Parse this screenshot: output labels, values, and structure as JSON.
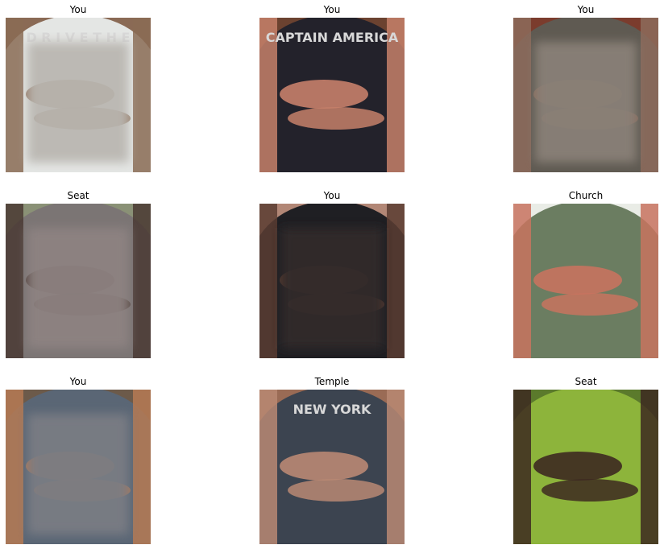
{
  "panels": [
    {
      "title": "You",
      "shirt": "#e4e6e4",
      "bg": "#8a6a55",
      "blurred": true,
      "blur_tone": "#b9b6b0",
      "skin": "#8a6b55",
      "print": "D R I V E T H E"
    },
    {
      "title": "You",
      "shirt": "#23222b",
      "bg": "#6b4230",
      "blurred": false,
      "skin": "#c6806a",
      "print": "CAPTAIN AMERICA"
    },
    {
      "title": "You",
      "shirt": "#5f5a52",
      "bg": "#7b3c2d",
      "blurred": true,
      "blur_tone": "#8a8178",
      "skin": "#8d6b5c",
      "print": ""
    },
    {
      "title": "Seat",
      "shirt": "#7b7574",
      "bg": "#8a9176",
      "blurred": true,
      "blur_tone": "#8e8382",
      "skin": "#4a3a34",
      "print": ""
    },
    {
      "title": "You",
      "shirt": "#1f1f23",
      "bg": "#b28776",
      "blurred": true,
      "blur_tone": "#322c2c",
      "skin": "#5b3d32",
      "print": ""
    },
    {
      "title": "Church",
      "shirt": "#6b7d61",
      "bg": "#e9ece6",
      "blurred": false,
      "skin": "#c8735f",
      "print": ""
    },
    {
      "title": "You",
      "shirt": "#5a6675",
      "bg": "#6c5a4a",
      "blurred": true,
      "blur_tone": "#7a7d84",
      "skin": "#b67a53",
      "print": ""
    },
    {
      "title": "Temple",
      "shirt": "#3c4450",
      "bg": "#9a6b55",
      "blurred": false,
      "skin": "#b98873",
      "print": "NEW YORK"
    },
    {
      "title": "Seat",
      "shirt": "#8db43b",
      "bg": "#5b7a2c",
      "blurred": false,
      "skin": "#3d2921",
      "print": ""
    }
  ]
}
